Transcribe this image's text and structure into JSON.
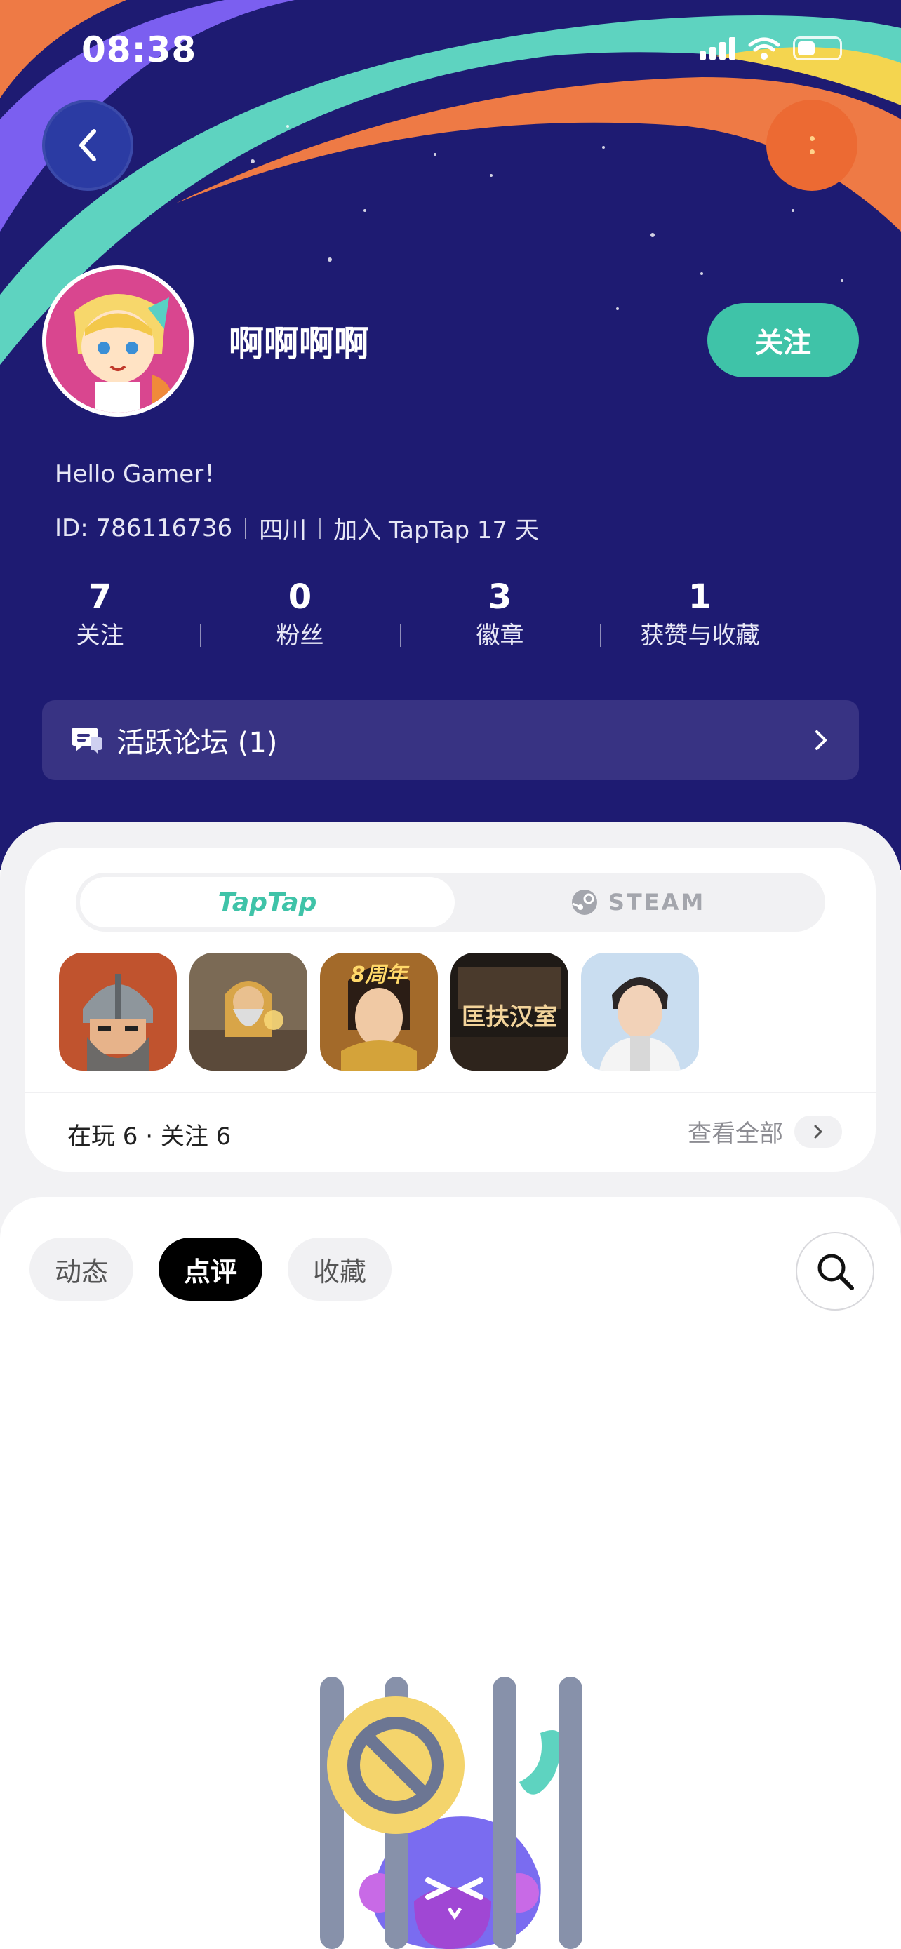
{
  "status_bar": {
    "time": "08:38"
  },
  "header": {
    "back_icon": "chevron-left-icon",
    "more_icon": "more-vertical-icon"
  },
  "profile": {
    "username": "啊啊啊啊",
    "follow_label": "关注",
    "bio": "Hello Gamer！",
    "id_text": "ID: 786116736",
    "location": "四川",
    "joined": "加入 TapTap 17 天"
  },
  "stats": [
    {
      "value": "7",
      "label": "关注"
    },
    {
      "value": "0",
      "label": "粉丝"
    },
    {
      "value": "3",
      "label": "徽章"
    },
    {
      "value": "1",
      "label": "获赞与收藏"
    }
  ],
  "forum": {
    "label": "活跃论坛 (1)"
  },
  "games_card": {
    "platform_tabs": [
      "TapTap",
      "STEAM"
    ],
    "selected_platform": "TapTap",
    "games": [
      {
        "name": "game-1",
        "text": ""
      },
      {
        "name": "game-2",
        "text": ""
      },
      {
        "name": "game-3",
        "text": "8周年"
      },
      {
        "name": "game-4",
        "text": "匡扶汉室"
      },
      {
        "name": "game-5",
        "text": ""
      }
    ],
    "summary": "在玩 6 · 关注 6",
    "view_all": "查看全部"
  },
  "feed": {
    "tabs": [
      "动态",
      "点评",
      "收藏"
    ],
    "active_tab": "点评"
  },
  "colors": {
    "hero_bg": "#1e1b72",
    "accent_green": "#3fc3a8",
    "orange": "#ec6a33"
  }
}
